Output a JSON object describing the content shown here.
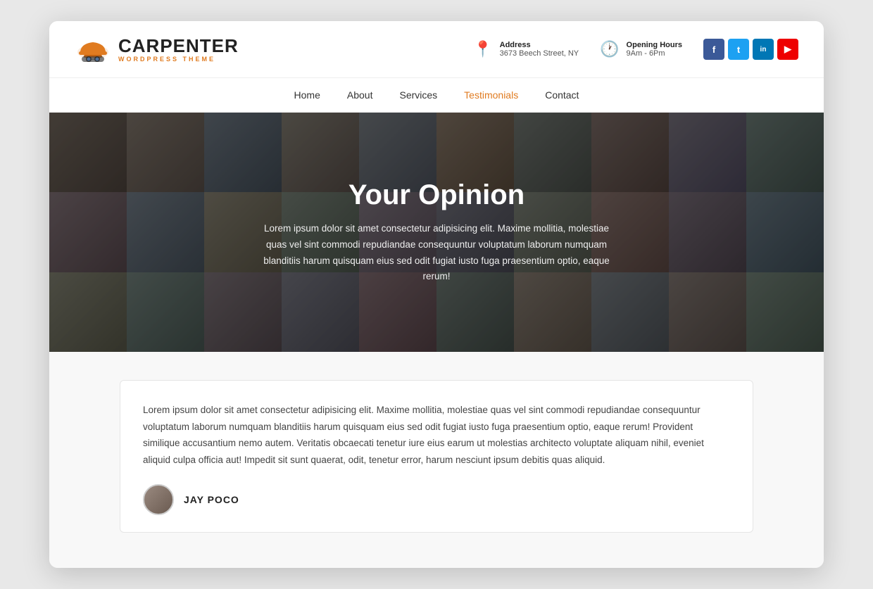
{
  "header": {
    "logo": {
      "main": "CARPENTER",
      "sub": "WORDPRESS THEME"
    },
    "address": {
      "label": "Address",
      "value": "3673 Beech Street, NY"
    },
    "hours": {
      "label": "Opening Hours",
      "value": "9Am - 6Pm"
    },
    "social": [
      {
        "name": "facebook",
        "label": "f",
        "class": "social-fb"
      },
      {
        "name": "twitter",
        "label": "t",
        "class": "social-tw"
      },
      {
        "name": "linkedin",
        "label": "in",
        "class": "social-li"
      },
      {
        "name": "youtube",
        "label": "▶",
        "class": "social-yt"
      }
    ]
  },
  "nav": {
    "items": [
      {
        "label": "Home",
        "active": false
      },
      {
        "label": "About",
        "active": false
      },
      {
        "label": "Services",
        "active": false
      },
      {
        "label": "Testimonials",
        "active": true
      },
      {
        "label": "Contact",
        "active": false
      }
    ]
  },
  "hero": {
    "title": "Your Opinion",
    "description": "Lorem ipsum dolor sit amet consectetur adipisicing elit. Maxime mollitia, molestiae quas vel sint commodi repudiandae consequuntur voluptatum laborum numquam blanditiis harum quisquam eius sed odit fugiat iusto fuga praesentium optio, eaque rerum!"
  },
  "testimonial": {
    "text": "Lorem ipsum dolor sit amet consectetur adipisicing elit. Maxime mollitia, molestiae quas vel sint commodi repudiandae consequuntur voluptatum laborum numquam blanditiis harum quisquam eius sed odit fugiat iusto fuga praesentium optio, eaque rerum! Provident similique accusantium nemo autem. Veritatis obcaecati tenetur iure eius earum ut molestias architecto voluptate aliquam nihil, eveniet aliquid culpa officia aut! Impedit sit sunt quaerat, odit, tenetur error, harum nesciunt ipsum debitis quas aliquid.",
    "author": "JAY POCO"
  },
  "colors": {
    "accent": "#e07b20",
    "nav_active": "#e07b20"
  }
}
